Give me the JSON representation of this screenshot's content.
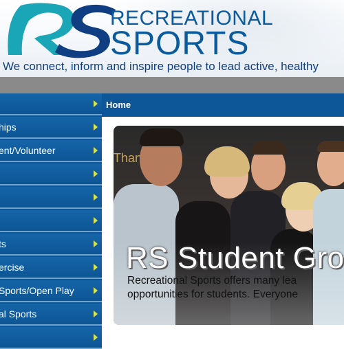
{
  "header": {
    "brand_line1": "RECREATIONAL",
    "brand_line2": "SPORTS",
    "logo_letters": "RS",
    "tagline": "We connect, inform and inspire people to lead active, healthy"
  },
  "sidebar": {
    "items": [
      {
        "label": ""
      },
      {
        "label": "hips"
      },
      {
        "label": "ent/Volunteer"
      },
      {
        "label": ""
      },
      {
        "label": ""
      },
      {
        "label": ""
      },
      {
        "label": "ts"
      },
      {
        "label": "ercise"
      },
      {
        "label": "Sports/Open Play"
      },
      {
        "label": "al Sports"
      },
      {
        "label": ""
      }
    ]
  },
  "breadcrumb": "Home",
  "hero": {
    "title": "RS Student Gro",
    "body_line1": "Recreational Sports offers many lea",
    "body_line2": "opportunities for students. Everyone",
    "background_text": "Than"
  },
  "colors": {
    "brand_blue": "#0b5a9c",
    "nav_blue": "#0e5596",
    "teal": "#1aa6b7",
    "chevron": "#d6e45a",
    "band_grey": "#8a8a8a"
  }
}
